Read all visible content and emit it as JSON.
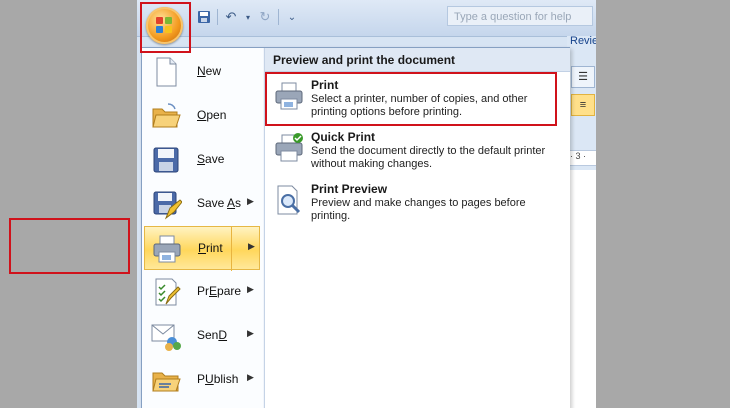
{
  "colors": {
    "highlight": "#d0121b",
    "active_item": "#ffd75c",
    "menu_border": "#86a0c2"
  },
  "search": {
    "placeholder": "Type a question for help"
  },
  "ribbon": {
    "tab_label": "Revie",
    "ruler_label": "· 3 ·"
  },
  "left_menu": {
    "items": [
      {
        "label": "New",
        "mnemonic": "N",
        "icon": "new-document-icon",
        "has_submenu": false
      },
      {
        "label": "Open",
        "mnemonic": "O",
        "icon": "open-folder-icon",
        "has_submenu": false
      },
      {
        "label": "Save",
        "mnemonic": "S",
        "icon": "save-disk-icon",
        "has_submenu": false
      },
      {
        "label": "Save As",
        "mnemonic": "A",
        "icon": "save-as-icon",
        "has_submenu": true
      },
      {
        "label": "Print",
        "mnemonic": "P",
        "icon": "printer-icon",
        "has_submenu": true,
        "active": true
      },
      {
        "label": "Prepare",
        "mnemonic": "E",
        "icon": "prepare-icon",
        "has_submenu": true
      },
      {
        "label": "Send",
        "mnemonic": "D",
        "icon": "send-icon",
        "has_submenu": true
      },
      {
        "label": "Publish",
        "mnemonic": "U",
        "icon": "publish-icon",
        "has_submenu": true
      }
    ]
  },
  "submenu": {
    "header": "Preview and print the document",
    "items": [
      {
        "title": "Print",
        "description": "Select a printer, number of copies, and other printing options before printing.",
        "icon": "printer-icon"
      },
      {
        "title": "Quick Print",
        "description": "Send the document directly to the default printer without making changes.",
        "icon": "quick-print-icon"
      },
      {
        "title": "Print Preview",
        "description": "Preview and make changes to pages before printing.",
        "icon": "print-preview-icon"
      }
    ]
  }
}
